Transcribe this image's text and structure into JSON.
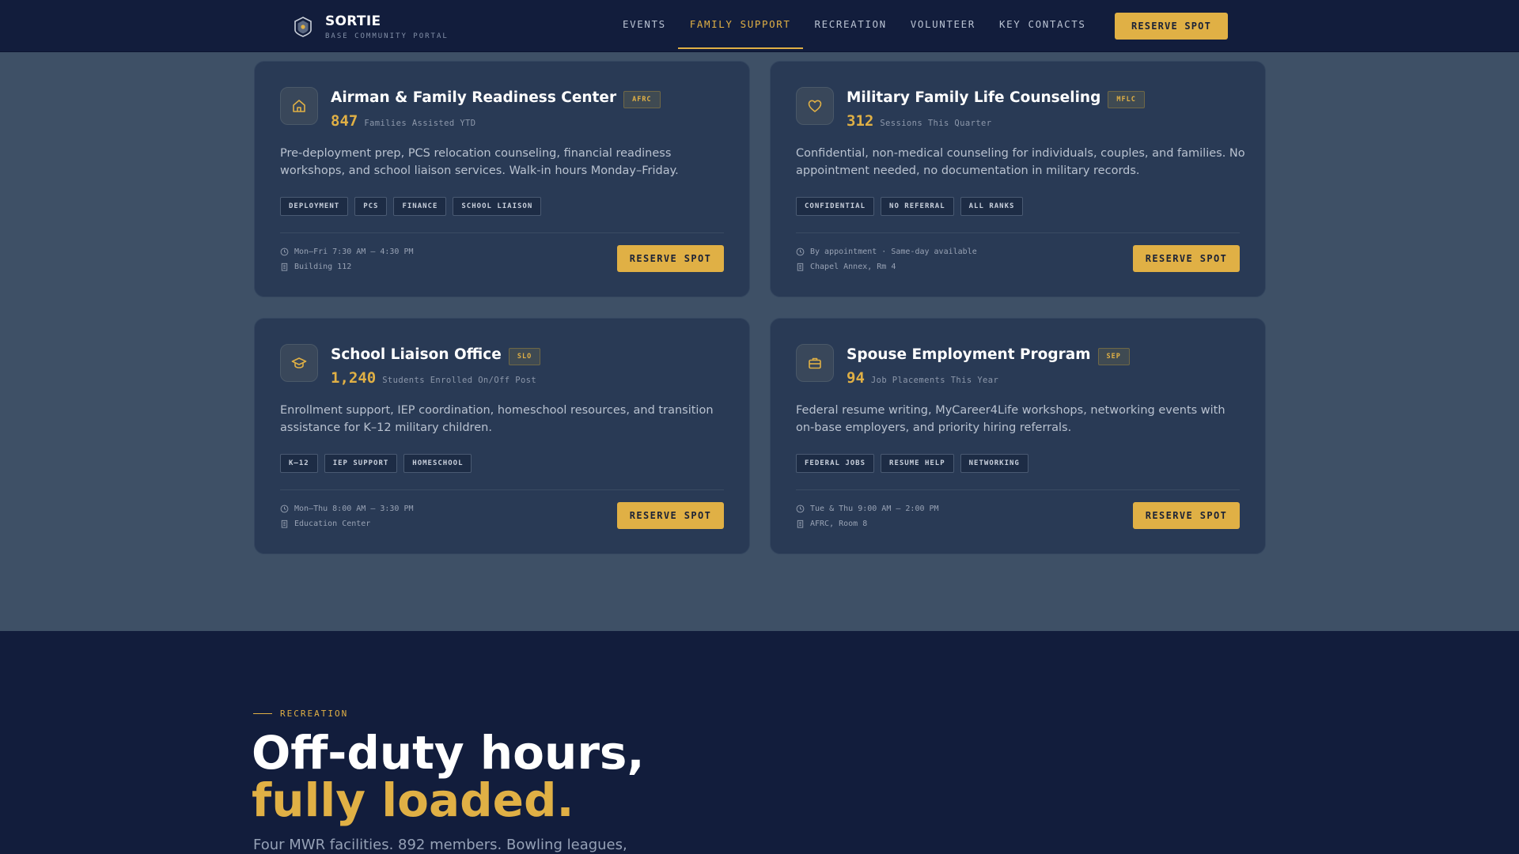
{
  "nav": {
    "brand_name": "SORTIE",
    "brand_sub": "BASE COMMUNITY PORTAL",
    "links": [
      "EVENTS",
      "FAMILY SUPPORT",
      "RECREATION",
      "VOLUNTEER",
      "KEY CONTACTS"
    ],
    "active_link": "FAMILY SUPPORT",
    "cta_label": "RESERVE SPOT"
  },
  "cards": [
    {
      "icon": "home-icon",
      "title": "Airman & Family Readiness Center",
      "badge": "AFRC",
      "metric_value": "847",
      "metric_label": "Families Assisted YTD",
      "description": "Pre-deployment prep, PCS relocation counseling, financial readiness workshops, and school liaison services. Walk-in hours Monday–Friday.",
      "tags": [
        "DEPLOYMENT",
        "PCS",
        "FINANCE",
        "SCHOOL LIAISON"
      ],
      "hours": "Mon–Fri 7:30 AM – 4:30 PM",
      "location": "Building 112",
      "button_label": "RESERVE SPOT"
    },
    {
      "icon": "heart-icon",
      "title": "Military Family Life Counseling",
      "badge": "MFLC",
      "metric_value": "312",
      "metric_label": "Sessions This Quarter",
      "description": "Confidential, non-medical counseling for individuals, couples, and families. No appointment needed, no documentation in military records.",
      "tags": [
        "CONFIDENTIAL",
        "NO REFERRAL",
        "ALL RANKS"
      ],
      "hours": "By appointment · Same-day available",
      "location": "Chapel Annex, Rm 4",
      "button_label": "RESERVE SPOT"
    },
    {
      "icon": "graduation-cap-icon",
      "title": "School Liaison Office",
      "badge": "SLO",
      "metric_value": "1,240",
      "metric_label": "Students Enrolled On/Off Post",
      "description": "Enrollment support, IEP coordination, homeschool resources, and transition assistance for K–12 military children.",
      "tags": [
        "K–12",
        "IEP SUPPORT",
        "HOMESCHOOL"
      ],
      "hours": "Mon–Thu 8:00 AM – 3:30 PM",
      "location": "Education Center",
      "button_label": "RESERVE SPOT"
    },
    {
      "icon": "briefcase-icon",
      "title": "Spouse Employment Program",
      "badge": "SEP",
      "metric_value": "94",
      "metric_label": "Job Placements This Year",
      "description": "Federal resume writing, MyCareer4Life workshops, networking events with on-base employers, and priority hiring referrals.",
      "tags": [
        "FEDERAL JOBS",
        "RESUME HELP",
        "NETWORKING"
      ],
      "hours": "Tue & Thu 9:00 AM – 2:00 PM",
      "location": "AFRC, Room 8",
      "button_label": "RESERVE SPOT"
    }
  ],
  "recreation": {
    "eyebrow": "RECREATION",
    "headline_line1": "Off-duty hours,",
    "headline_line2": "fully loaded.",
    "subtitle": "Four MWR facilities. 892 members. Bowling leagues,"
  },
  "colors": {
    "nav_bg": "#121d3c",
    "page_bg": "#3e5066",
    "card_bg": "#293a55",
    "accent": "#e0b045"
  }
}
